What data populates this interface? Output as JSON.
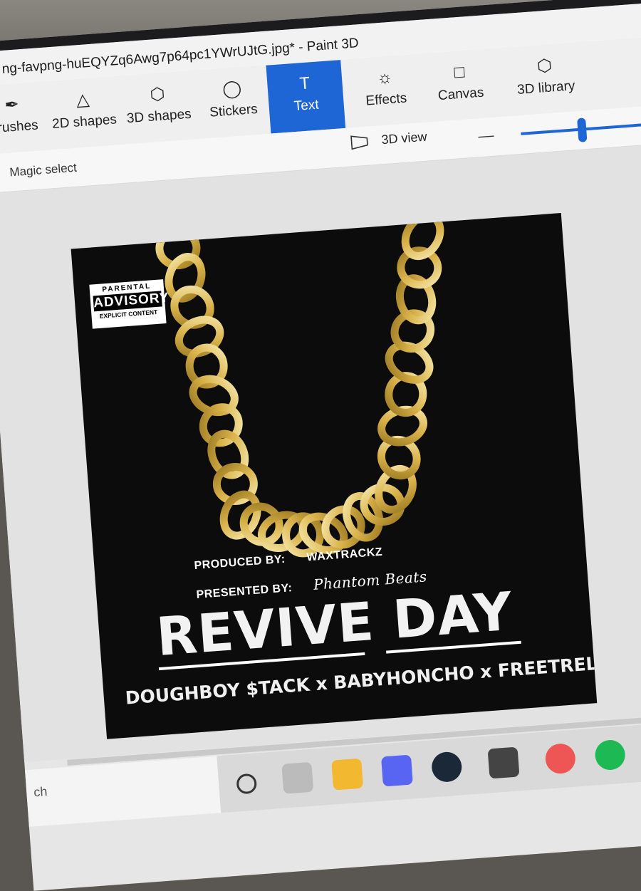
{
  "window": {
    "title": "ng-favpng-huEQYZq6Awg7p64pc1YWrUJtG.jpg* - Paint 3D"
  },
  "ribbon": {
    "tools": [
      {
        "label": "Brushes",
        "icon": "brush-icon"
      },
      {
        "label": "2D shapes",
        "icon": "2d-shapes-icon"
      },
      {
        "label": "3D shapes",
        "icon": "3d-shapes-icon"
      },
      {
        "label": "Stickers",
        "icon": "stickers-icon"
      },
      {
        "label": "Text",
        "icon": "text-icon",
        "active": true
      },
      {
        "label": "Effects",
        "icon": "effects-icon"
      },
      {
        "label": "Canvas",
        "icon": "canvas-icon"
      },
      {
        "label": "3D library",
        "icon": "3d-library-icon"
      }
    ]
  },
  "subbar": {
    "magic_select": "Magic select",
    "view3d": "3D view",
    "zoom_minus": "—"
  },
  "cover": {
    "advisory_line1": "PARENTAL",
    "advisory_line2": "ADVISORY",
    "advisory_line3": "EXPLICIT CONTENT",
    "produced_label": "PRODUCED BY:",
    "produced_value": "WAXTRACKZ",
    "presented_label": "PRESENTED BY:",
    "presented_value": "Phantom Beats",
    "title": "REVIVE DAY",
    "artists": "DOUGHBOY $TACK x BABYHONCHO x FREETREL"
  },
  "taskbar": {
    "search_text": "ch"
  },
  "colors": {
    "accent": "#1e66d6",
    "cover_bg": "#0c0c0c",
    "gold": "#d9b24a"
  }
}
